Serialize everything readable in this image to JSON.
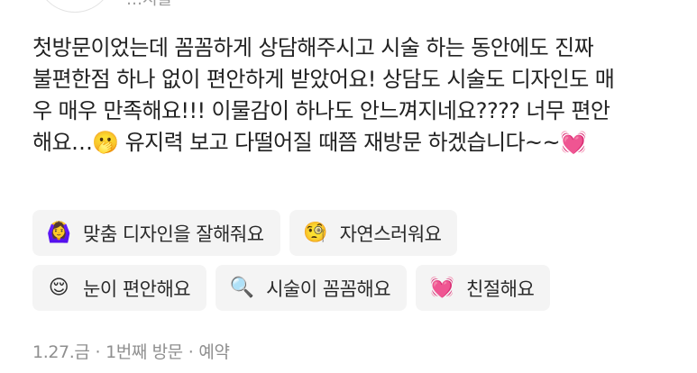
{
  "header": {
    "partial_text": "…시술"
  },
  "review": {
    "lines": [
      "첫방문이었는데 꼼꼼하게 상담해주시고 시술 하는 동안에도 진짜",
      "불편한점 하나 없이 편안하게 받았어요! 상담도 시술도 디자인도 매",
      "우 매우 만족해요!!! 이물감이 하나도 안느껴지네요???? 너무 편안",
      "해요…🫢 유지력 보고 다떨어질 때쯤 재방문 하겠습니다~~💓"
    ]
  },
  "tags": [
    {
      "icon": "🙆‍♀️",
      "icon_name": "woman-gesturing-ok-icon",
      "label": "맞춤 디자인을 잘해줘요"
    },
    {
      "icon": "🧐",
      "icon_name": "face-with-monocle-icon",
      "label": "자연스러워요"
    },
    {
      "icon": "😌",
      "icon_name": "relieved-face-icon",
      "label": "눈이 편안해요"
    },
    {
      "icon": "🔍",
      "icon_name": "magnifying-glass-icon",
      "label": "시술이 꼼꼼해요"
    },
    {
      "icon": "💓",
      "icon_name": "beating-heart-icon",
      "label": "친절해요"
    }
  ],
  "meta": {
    "date": "1.27.금",
    "visit": "1번째 방문",
    "type": "예약"
  }
}
